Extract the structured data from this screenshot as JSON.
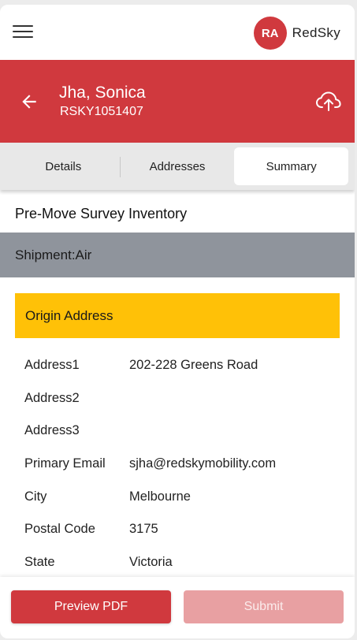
{
  "app": {
    "brand_initials": "RA",
    "brand_name": "RedSky"
  },
  "header": {
    "customer_name": "Jha, Sonica",
    "customer_id": "RSKY1051407"
  },
  "tabs": [
    {
      "label": "Details",
      "active": false
    },
    {
      "label": "Addresses",
      "active": false
    },
    {
      "label": "Summary",
      "active": true
    }
  ],
  "content": {
    "section_title": "Pre-Move Survey Inventory",
    "shipment": "Shipment:Air",
    "origin_title": "Origin Address",
    "address_rows": [
      {
        "label": "Address1",
        "value": "202-228 Greens Road"
      },
      {
        "label": "Address2",
        "value": ""
      },
      {
        "label": "Address3",
        "value": ""
      },
      {
        "label": "Primary Email",
        "value": "sjha@redskymobility.com"
      },
      {
        "label": "City",
        "value": "Melbourne"
      },
      {
        "label": "Postal Code",
        "value": "3175"
      },
      {
        "label": "State",
        "value": "Victoria"
      }
    ]
  },
  "footer": {
    "preview_label": "Preview PDF",
    "submit_label": "Submit"
  },
  "colors": {
    "brand_red": "#d0393e",
    "shipment_gray": "#8f949c",
    "origin_yellow": "#ffc107",
    "disabled_red": "#e8a0a2"
  },
  "icons": {
    "menu": "hamburger-menu-icon",
    "back": "arrow-left-icon",
    "upload": "cloud-upload-icon"
  }
}
